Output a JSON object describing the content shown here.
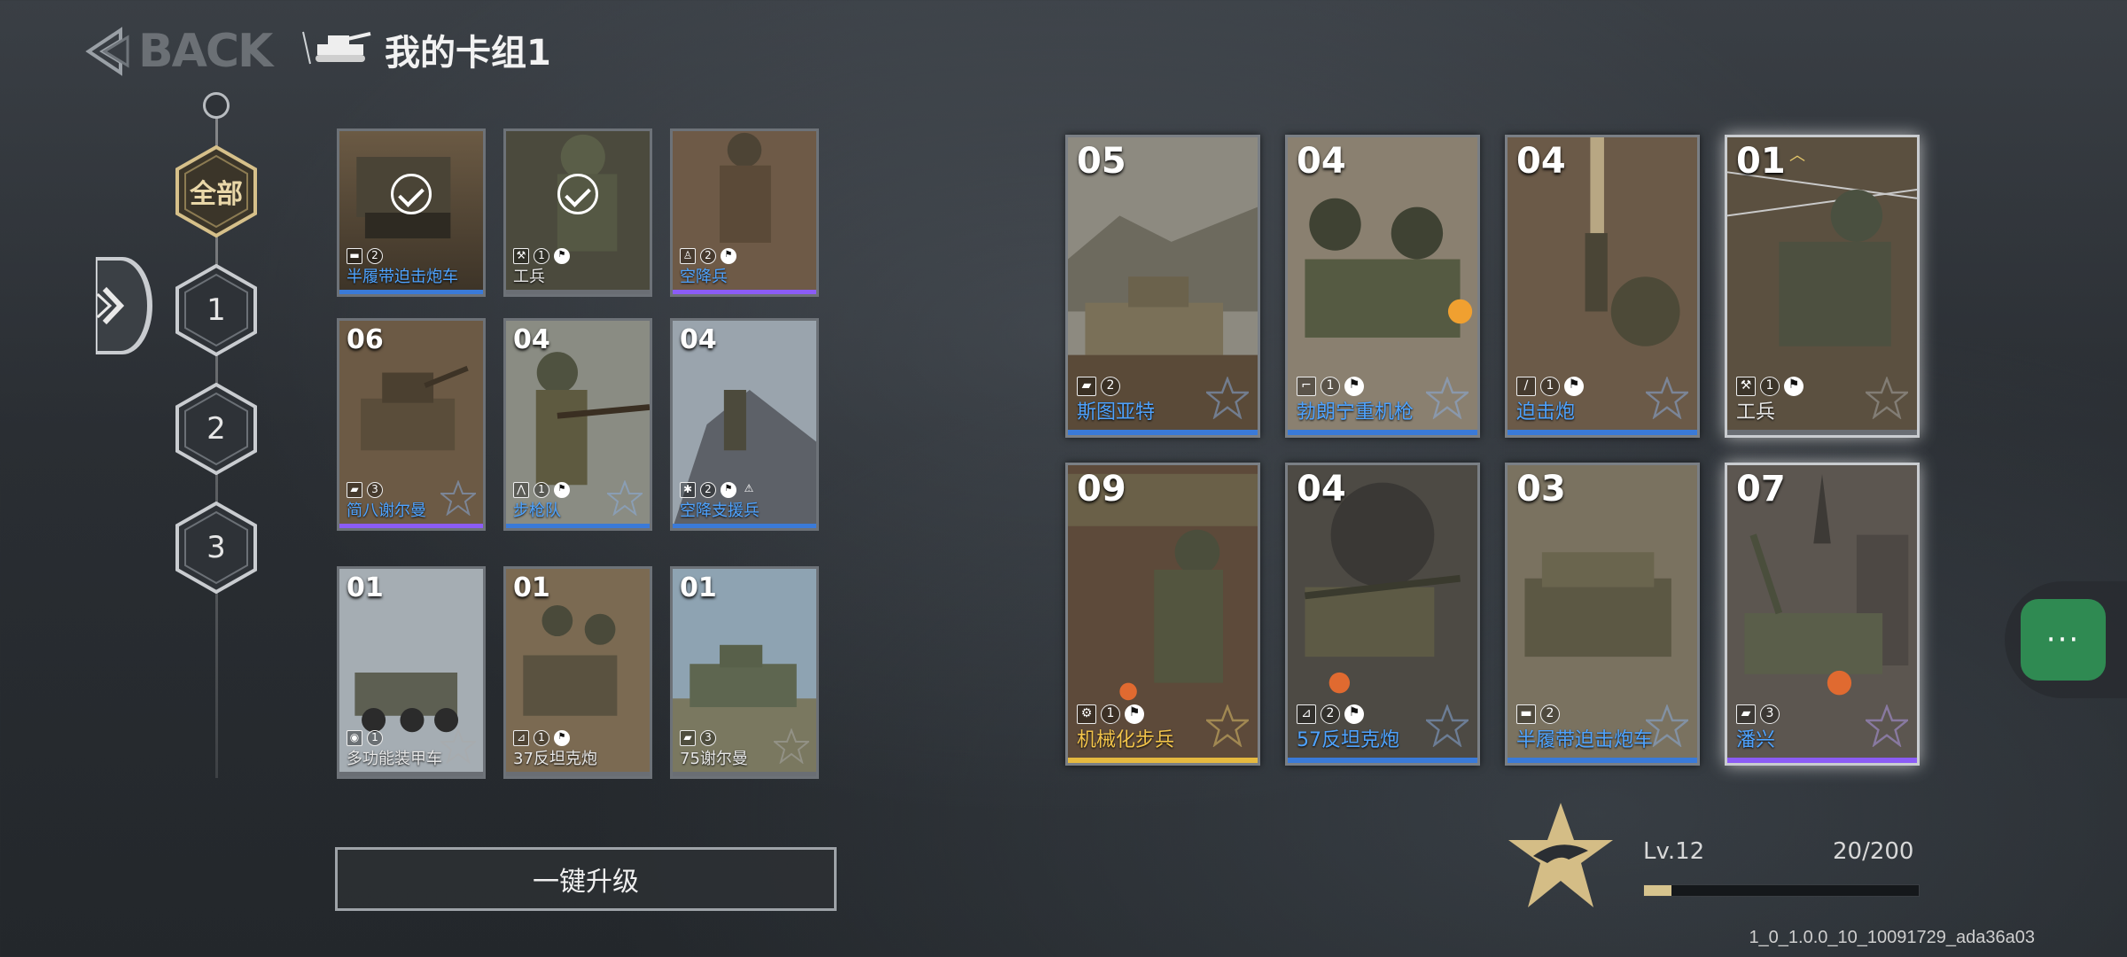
{
  "header": {
    "back_label": "BACK",
    "deck_title": "我的卡组1",
    "icons": [
      "back-arrow-icon",
      "tank-icon"
    ]
  },
  "filters": [
    {
      "label": "全部",
      "active": true
    },
    {
      "label": "1",
      "active": false
    },
    {
      "label": "2",
      "active": false
    },
    {
      "label": "3",
      "active": false
    }
  ],
  "collection": [
    {
      "cost": "",
      "name": "半履带迫击炮车",
      "icons": [
        "2"
      ],
      "bar": "blue",
      "checked": true
    },
    {
      "cost": "",
      "name": "工兵",
      "icons": [
        "1"
      ],
      "bar": "grey",
      "checked": true
    },
    {
      "cost": "",
      "name": "空降兵",
      "icons": [
        "2"
      ],
      "bar": "purple",
      "checked": false
    },
    {
      "cost": "06",
      "name": "简八谢尔曼",
      "icons": [
        "3"
      ],
      "bar": "purple"
    },
    {
      "cost": "04",
      "name": "步枪队",
      "icons": [
        "1"
      ],
      "bar": "blue"
    },
    {
      "cost": "04",
      "name": "空降支援兵",
      "icons": [
        "2"
      ],
      "bar": "blue"
    },
    {
      "cost": "01",
      "name": "多功能装甲车",
      "icons": [
        "1"
      ],
      "bar": "grey"
    },
    {
      "cost": "01",
      "name": "37反坦克炮",
      "icons": [
        "1"
      ],
      "bar": "grey"
    },
    {
      "cost": "01",
      "name": "75谢尔曼",
      "icons": [
        "3"
      ],
      "bar": "grey"
    }
  ],
  "deck": [
    {
      "cost": "05",
      "name": "斯图亚特",
      "icons": [
        "2"
      ],
      "bar": "blue",
      "name_color": "blue"
    },
    {
      "cost": "04",
      "name": "勃朗宁重机枪",
      "icons": [
        "1"
      ],
      "bar": "blue",
      "name_color": "blue"
    },
    {
      "cost": "04",
      "name": "迫击炮",
      "icons": [
        "1"
      ],
      "bar": "blue",
      "name_color": "blue"
    },
    {
      "cost": "01",
      "name": "工兵",
      "icons": [
        "1"
      ],
      "bar": "grey",
      "name_color": "white"
    },
    {
      "cost": "09",
      "name": "机械化步兵",
      "icons": [
        "1"
      ],
      "bar": "gold",
      "name_color": "gold"
    },
    {
      "cost": "04",
      "name": "57反坦克炮",
      "icons": [
        "2"
      ],
      "bar": "blue",
      "name_color": "blue"
    },
    {
      "cost": "03",
      "name": "半履带迫击炮车",
      "icons": [
        "2"
      ],
      "bar": "blue",
      "name_color": "blue"
    },
    {
      "cost": "07",
      "name": "潘兴",
      "icons": [
        "3"
      ],
      "bar": "purple",
      "name_color": "blue"
    }
  ],
  "upgrade_button": "一键升级",
  "level": {
    "label": "Lv.12",
    "xp": "20/200",
    "progress": 0.1
  },
  "chat_button": "···",
  "version": "1_0_1.0.0_10_10091729_ada36a03",
  "colors": {
    "blue": "#3a7ad8",
    "purple": "#8b5cf6",
    "gold": "#e5b93f",
    "chat_green": "#2f8a52"
  }
}
